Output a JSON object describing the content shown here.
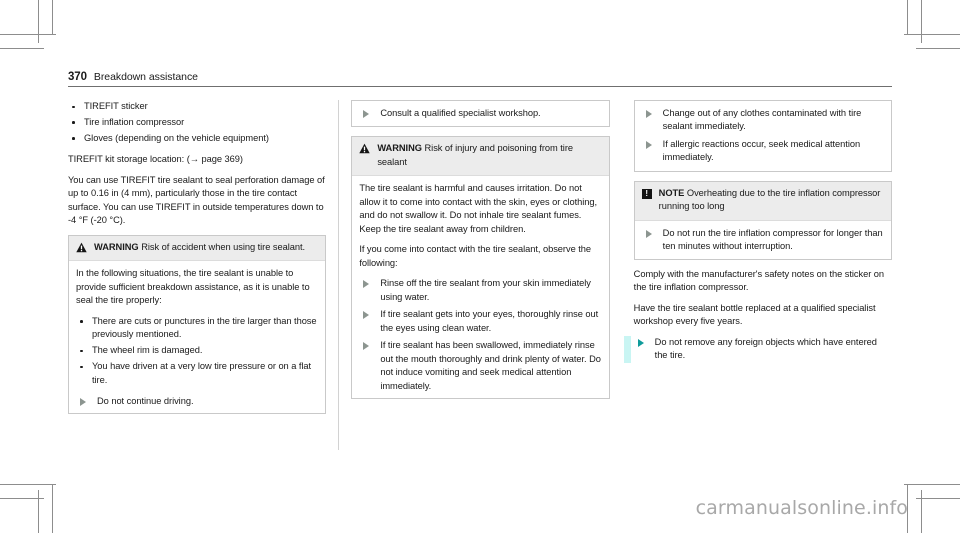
{
  "header": {
    "page_number": "370",
    "chapter": "Breakdown assistance"
  },
  "watermark": "carmanualsonline.info",
  "icons": {
    "warning": "warning-triangle-icon",
    "note": "note-exclamation-icon",
    "action": "action-triangle-icon",
    "bullet": "bullet-dot-icon",
    "pageref": "arrow-right-icon"
  },
  "labels": {
    "warning": "WARNING",
    "note": "NOTE"
  },
  "col1": {
    "kit_items": [
      "TIREFIT sticker",
      "Tire inflation compressor",
      "Gloves (depending on the vehicle equipment)"
    ],
    "storage_location": "TIREFIT kit storage location: (→ page 369)",
    "intro_paragraph": "You can use TIREFIT tire sealant to seal perforation damage of up to 0.16 in (4 mm), particularly those in the tire contact surface. You can use TIREFIT in outside temperatures down to -4 °F (-20 °C).",
    "warning_box": {
      "title": "WARNING",
      "headline": "Risk of accident when using tire sealant.",
      "intro": "In the following situations, the tire sealant is unable to provide sufficient breakdown assistance, as it is unable to seal the tire properly:",
      "bullets": [
        "There are cuts or punctures in the tire larger than those previously mentioned.",
        "The wheel rim is damaged.",
        "You have driven at a very low tire pressure or on a flat tire."
      ],
      "actions": [
        "Do not continue driving."
      ]
    }
  },
  "col2": {
    "consult_box": {
      "actions": [
        "Consult a qualified specialist workshop."
      ]
    },
    "warning_box": {
      "title": "WARNING",
      "headline": "Risk of injury and poisoning from tire sealant",
      "paragraphs": [
        "The tire sealant is harmful and causes irritation. Do not allow it to come into contact with the skin, eyes or clothing, and do not swallow it. Do not inhale tire sealant fumes. Keep the tire sealant away from children.",
        "If you come into contact with the tire sealant, observe the following:"
      ],
      "actions": [
        "Rinse off the tire sealant from your skin immediately using water.",
        "If tire sealant gets into your eyes, thoroughly rinse out the eyes using clean water.",
        "If tire sealant has been swallowed, immediately rinse out the mouth thoroughly and drink plenty of water. Do not induce vomiting and seek medical attention immediately."
      ]
    }
  },
  "col3": {
    "continued_actions_box": {
      "actions": [
        "Change out of any clothes contaminated with tire sealant immediately.",
        "If allergic reactions occur, seek medical attention immediately."
      ]
    },
    "note_box": {
      "title": "NOTE",
      "headline": "Overheating due to the tire inflation compressor running too long",
      "actions": [
        "Do not run the tire inflation compressor for longer than ten minutes without interruption."
      ]
    },
    "closing_paragraphs": [
      "Comply with the manufacturer's safety notes on the sticker on the tire inflation compressor.",
      "Have the tire sealant bottle replaced at a qualified specialist workshop every five years."
    ],
    "changed_actions": [
      "Do not remove any foreign objects which have entered the tire."
    ]
  },
  "colors": {
    "change_bar": "#c9f5f3",
    "change_triangle": "#0f9b9b",
    "action_triangle": "#8c9590",
    "band_background": "#ececec",
    "box_border": "#c9c9c9",
    "watermark": "#a8a8a8"
  }
}
